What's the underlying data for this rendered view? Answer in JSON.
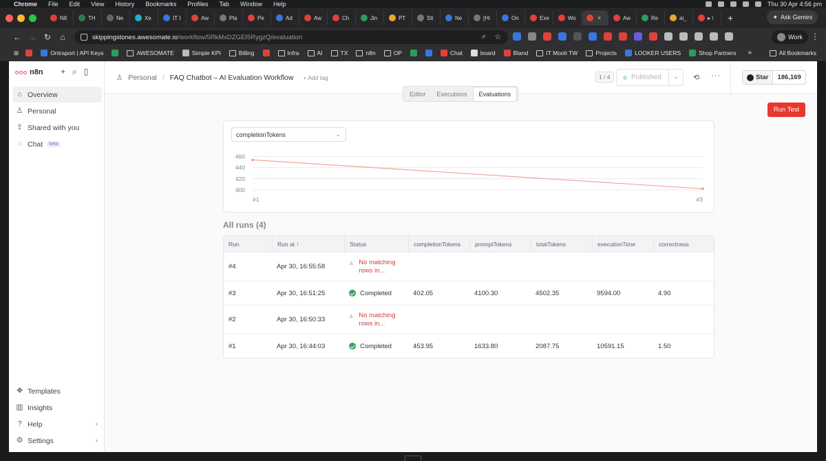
{
  "os": {
    "apple": "",
    "app_name": "Chrome",
    "menu": [
      "File",
      "Edit",
      "View",
      "History",
      "Bookmarks",
      "Profiles",
      "Tab",
      "Window",
      "Help"
    ],
    "clock": "Thu 30 Apr  4:56 pm"
  },
  "browser": {
    "tabs": [
      {
        "label": "N8",
        "color": "#e0413a"
      },
      {
        "label": "TH",
        "color": "#2a7d52"
      },
      {
        "label": "Ne",
        "color": "#666666"
      },
      {
        "label": "Xe",
        "color": "#19b5c9"
      },
      {
        "label": "IT I",
        "color": "#3a76e0"
      },
      {
        "label": "Aw",
        "color": "#e0413a"
      },
      {
        "label": "Pla",
        "color": "#777777"
      },
      {
        "label": "Pe",
        "color": "#e0413a"
      },
      {
        "label": "Ad",
        "color": "#3a76e0"
      },
      {
        "label": "Aw",
        "color": "#e0413a"
      },
      {
        "label": "Ch",
        "color": "#e0413a"
      },
      {
        "label": "Jin",
        "color": "#2a9d5b"
      },
      {
        "label": "PT",
        "color": "#e9a92b"
      },
      {
        "label": "Sti",
        "color": "#777777"
      },
      {
        "label": "Ne",
        "color": "#3a76e0"
      },
      {
        "label": "[Hi",
        "color": "#777777"
      },
      {
        "label": "On",
        "color": "#3a76e0"
      },
      {
        "label": "Exe",
        "color": "#e0413a"
      },
      {
        "label": "Wo",
        "color": "#e0413a"
      }
    ],
    "active_tab": {
      "label": "",
      "close": "×",
      "color": "#e0413a"
    },
    "tabs_after": [
      {
        "label": "Aw",
        "color": "#e0413a"
      },
      {
        "label": "Re",
        "color": "#2a9d5b"
      },
      {
        "label": "ai_",
        "color": "#e9a92b"
      },
      {
        "label": "▸ \\",
        "color": "#e0413a"
      }
    ],
    "new_tab": "+",
    "ask_gemini": "Ask Gemini",
    "url_host": "skippingstones.awesomate.io",
    "url_path": "/workflow/5RkMxDZGEI5RygzQ/evaluation",
    "profile": "Work",
    "bookmarks": [
      {
        "label": "",
        "type": "icon",
        "color": "#e0413a"
      },
      {
        "label": "Ontraport | API Keys",
        "type": "color",
        "color": "#3a76e0"
      },
      {
        "label": "",
        "type": "color",
        "color": "#2a9d5b"
      },
      {
        "label": "AWESOMATE",
        "type": "folder"
      },
      {
        "label": "Simple KPI",
        "type": "color",
        "color": "#bbbbbb"
      },
      {
        "label": "Billing",
        "type": "folder"
      },
      {
        "label": "",
        "type": "color",
        "color": "#e0413a"
      },
      {
        "label": "Infra",
        "type": "folder"
      },
      {
        "label": "AI",
        "type": "folder"
      },
      {
        "label": "TX",
        "type": "folder"
      },
      {
        "label": "n8n",
        "type": "folder"
      },
      {
        "label": "OP",
        "type": "folder"
      },
      {
        "label": "",
        "type": "color",
        "color": "#2a9d5b"
      },
      {
        "label": "",
        "type": "color",
        "color": "#3a76e0"
      },
      {
        "label": "Chat",
        "type": "color",
        "color": "#e0413a"
      },
      {
        "label": "board",
        "type": "color",
        "color": "#dddddd"
      },
      {
        "label": "Bland",
        "type": "color",
        "color": "#e0413a"
      },
      {
        "label": "IT Mooti TW",
        "type": "folder"
      },
      {
        "label": "Projects",
        "type": "folder"
      },
      {
        "label": "LOOKER USERS",
        "type": "color",
        "color": "#3a76e0"
      },
      {
        "label": "Shop Partners",
        "type": "color",
        "color": "#2a9d5b"
      }
    ],
    "more_bookmarks": "»",
    "all_bookmarks": "All Bookmarks"
  },
  "sidebar": {
    "logo": "n8n",
    "items": [
      {
        "label": "Overview",
        "icon": "home-icon",
        "glyph": "⌂"
      },
      {
        "label": "Personal",
        "icon": "user-icon",
        "glyph": "♙"
      },
      {
        "label": "Shared with you",
        "icon": "share-icon",
        "glyph": "⇪"
      },
      {
        "label": "Chat",
        "icon": "chat-icon",
        "glyph": "◌",
        "badge": "beta"
      }
    ],
    "bottom": [
      {
        "label": "Templates",
        "icon": "templates-icon",
        "glyph": "❖"
      },
      {
        "label": "Insights",
        "icon": "insights-icon",
        "glyph": "▥"
      },
      {
        "label": "Help",
        "icon": "help-icon",
        "glyph": "?",
        "chevron": "›"
      },
      {
        "label": "Settings",
        "icon": "settings-icon",
        "glyph": "⚙",
        "chevron": "›"
      }
    ]
  },
  "header": {
    "breadcrumb_project": "Personal",
    "breadcrumb_separator": "/",
    "workflow_name": "FAQ Chatbot – AI Evaluation Workflow",
    "add_tag": "+ Add tag",
    "counter": "1 / 4",
    "published_label": "Published",
    "github_star": "Star",
    "github_count": "186,169"
  },
  "view_tabs": [
    "Editor",
    "Executions",
    "Evaluations"
  ],
  "active_view": "Evaluations",
  "run_test": "Run Test",
  "chart_data": {
    "type": "line",
    "metric_selected": "completionTokens",
    "categories": [
      "#1",
      "#3"
    ],
    "values": [
      453.95,
      402.05
    ],
    "yticks": [
      460,
      440,
      420,
      400
    ],
    "ylim": [
      395,
      468
    ],
    "line_color": "#f2a39c"
  },
  "runs_title": "All runs (4)",
  "table": {
    "headers": [
      "Run",
      "Run at ↑",
      "Status",
      "completionTokens",
      "promptTokens",
      "totalTokens",
      "executionTime",
      "correctness"
    ],
    "rows": [
      {
        "run": "#4",
        "run_at": "Apr 30, 16:55:58",
        "status": "No matching rows in...",
        "status_line1": "No matching",
        "status_line2": "rows in...",
        "ok": false,
        "completionTokens": "",
        "promptTokens": "",
        "totalTokens": "",
        "executionTime": "",
        "correctness": ""
      },
      {
        "run": "#3",
        "run_at": "Apr 30, 16:51:25",
        "status": "Completed",
        "ok": true,
        "completionTokens": "402.05",
        "promptTokens": "4100.30",
        "totalTokens": "4502.35",
        "executionTime": "9594.00",
        "correctness": "4.90"
      },
      {
        "run": "#2",
        "run_at": "Apr 30, 16:50:33",
        "status": "No matching rows in...",
        "status_line1": "No matching",
        "status_line2": "rows in...",
        "ok": false,
        "completionTokens": "",
        "promptTokens": "",
        "totalTokens": "",
        "executionTime": "",
        "correctness": ""
      },
      {
        "run": "#1",
        "run_at": "Apr 30, 16:44:03",
        "status": "Completed",
        "ok": true,
        "completionTokens": "453.95",
        "promptTokens": "1633.80",
        "totalTokens": "2087.75",
        "executionTime": "10591.15",
        "correctness": "1.50"
      }
    ]
  }
}
